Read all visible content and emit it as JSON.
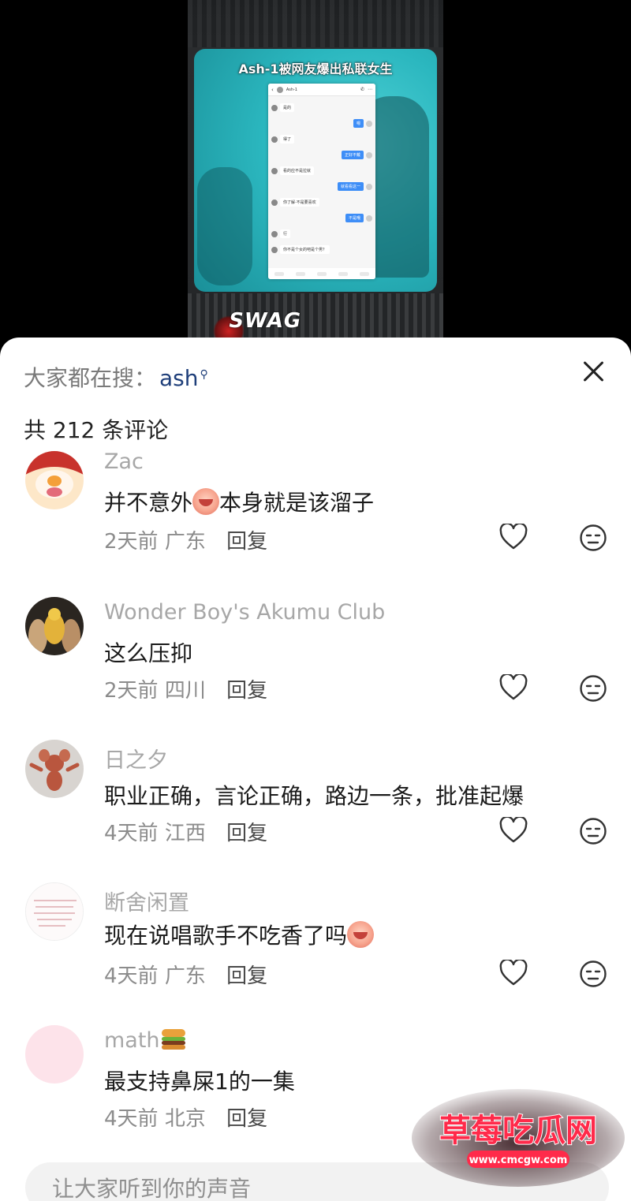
{
  "video": {
    "title": "Ash-1被网友爆出私联女生",
    "chat": {
      "contact": "Ash-1",
      "messages": [
        {
          "from": "other",
          "text": "是的"
        },
        {
          "from": "me",
          "text": "嗯"
        },
        {
          "from": "other",
          "text": "得了"
        },
        {
          "from": "me",
          "text": "正好不戴"
        },
        {
          "from": "other",
          "text": "看的应不是拉就"
        },
        {
          "from": "me",
          "text": "就看看这一"
        },
        {
          "from": "other",
          "text": "你了解·不是要喜欢"
        },
        {
          "from": "me",
          "text": "不是哦"
        },
        {
          "from": "other",
          "text": "行"
        },
        {
          "from": "other",
          "text": "你不是个女的吧是个男？"
        }
      ]
    },
    "logo_text": "SWAG"
  },
  "sheet": {
    "search_prefix": "大家都在搜：",
    "search_term": "ash",
    "comment_count": "共 212 条评论",
    "input_placeholder": "让大家听到你的声音"
  },
  "comments": [
    {
      "username": "Zac",
      "text_before": "并不意外",
      "emoji": "crying-face",
      "text_after": "本身就是该溜子",
      "time": "2天前",
      "location": "广东",
      "reply": "回复"
    },
    {
      "username": "Wonder Boy's Akumu Club",
      "text_before": "这么压抑",
      "emoji": "",
      "text_after": "",
      "time": "2天前",
      "location": "四川",
      "reply": "回复"
    },
    {
      "username": "日之夕",
      "text_before": "职业正确，言论正确，路边一条，批准起爆",
      "emoji": "",
      "text_after": "",
      "time": "4天前",
      "location": "江西",
      "reply": "回复"
    },
    {
      "username": "断舍闲置",
      "text_before": "现在说唱歌手不吃香了吗",
      "emoji": "crying-face",
      "text_after": "",
      "time": "4天前",
      "location": "广东",
      "reply": "回复"
    },
    {
      "username": "math",
      "username_emoji": "burger",
      "text_before": "最支持鼻屎1的一集",
      "emoji": "",
      "text_after": "",
      "time": "4天前",
      "location": "北京",
      "reply": "回复"
    }
  ],
  "watermark": {
    "title": "草莓吃瓜网",
    "url": "www.cmcgw.com"
  },
  "colors": {
    "sheet_bg": "#ffffff",
    "username": "#a7a7a7",
    "search_term": "#1f3f7a",
    "video_screen": "#2bb7bf"
  }
}
